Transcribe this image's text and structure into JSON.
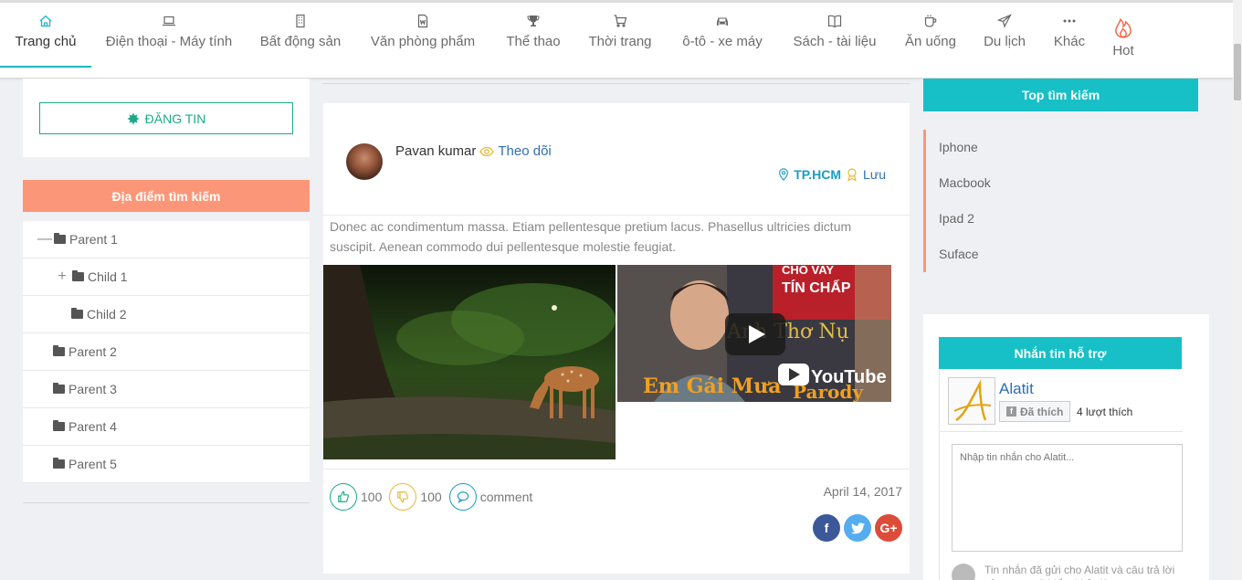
{
  "nav": {
    "items": [
      {
        "label": "Trang chủ",
        "icon": "home-icon"
      },
      {
        "label": "Điện thoại - Máy tính",
        "icon": "laptop-icon"
      },
      {
        "label": "Bất động sản",
        "icon": "building-icon"
      },
      {
        "label": "Văn phòng phẩm",
        "icon": "document-icon"
      },
      {
        "label": "Thể thao",
        "icon": "trophy-icon"
      },
      {
        "label": "Thời trang",
        "icon": "cart-icon"
      },
      {
        "label": "ô-tô - xe máy",
        "icon": "car-icon"
      },
      {
        "label": "Sách - tài liệu",
        "icon": "book-icon"
      },
      {
        "label": "Ăn uống",
        "icon": "cup-icon"
      },
      {
        "label": "Du lịch",
        "icon": "paper-plane-icon"
      },
      {
        "label": "Khác",
        "icon": "more-icon"
      },
      {
        "label": "Hot",
        "icon": "fire-icon"
      }
    ],
    "active_index": 0,
    "accent_color": "#1fb7c4"
  },
  "left": {
    "post_button": "ĐĂNG TIN",
    "location_header": "Địa điểm tìm kiếm",
    "tree": [
      {
        "label": "Parent 1",
        "toggle": "—"
      },
      {
        "label": "Child 1",
        "toggle": "+"
      },
      {
        "label": "Child 2",
        "toggle": ""
      },
      {
        "label": "Parent 2",
        "toggle": ""
      },
      {
        "label": "Parent 3",
        "toggle": ""
      },
      {
        "label": "Parent 4",
        "toggle": ""
      },
      {
        "label": "Parent 5",
        "toggle": ""
      }
    ],
    "header_color": "#fb9778"
  },
  "post": {
    "author": "Pavan kumar",
    "follow_label": "Theo dõi",
    "city": "TP.HCM",
    "save_label": "Lưu",
    "text": "Donec ac condimentum massa. Etiam pellentesque pretium lacus. Phasellus ultricies dictum suscipit. Aenean commodo dui pellentesque molestie feugiat.",
    "video": {
      "line1": "CHO VAY",
      "line2": "TÍN CHẤP",
      "caption_left": "Em Gái Mưa",
      "caption_right": "Parody",
      "overlay": "Anh Thơ Nụ",
      "youtube": "YouTube"
    },
    "likes": "100",
    "dislikes": "100",
    "comment_label": "comment",
    "date": "April 14, 2017",
    "share": [
      {
        "label": "f",
        "color": "#3b5998",
        "icon": "facebook-icon"
      },
      {
        "label": "t",
        "color": "#55acee",
        "icon": "twitter-icon"
      },
      {
        "label": "G+",
        "color": "#dd4b39",
        "icon": "google-plus-icon"
      }
    ]
  },
  "right": {
    "top_search_header": "Top tìm kiếm",
    "top_search_items": [
      "Iphone",
      "Macbook",
      "Ipad 2",
      "Suface"
    ],
    "support_header": "Nhắn tin hỗ trợ",
    "fb_page_name": "Alatit",
    "fb_like_label": "Đã thích",
    "fb_like_count": "4 lượt thích",
    "fb_placeholder": "Nhập tin nhắn cho Alatit...",
    "fb_footer_text": "Tin nhắn đã gửi cho Alatit và câu trả lời của trang sẽ hiển thị ở đây"
  }
}
